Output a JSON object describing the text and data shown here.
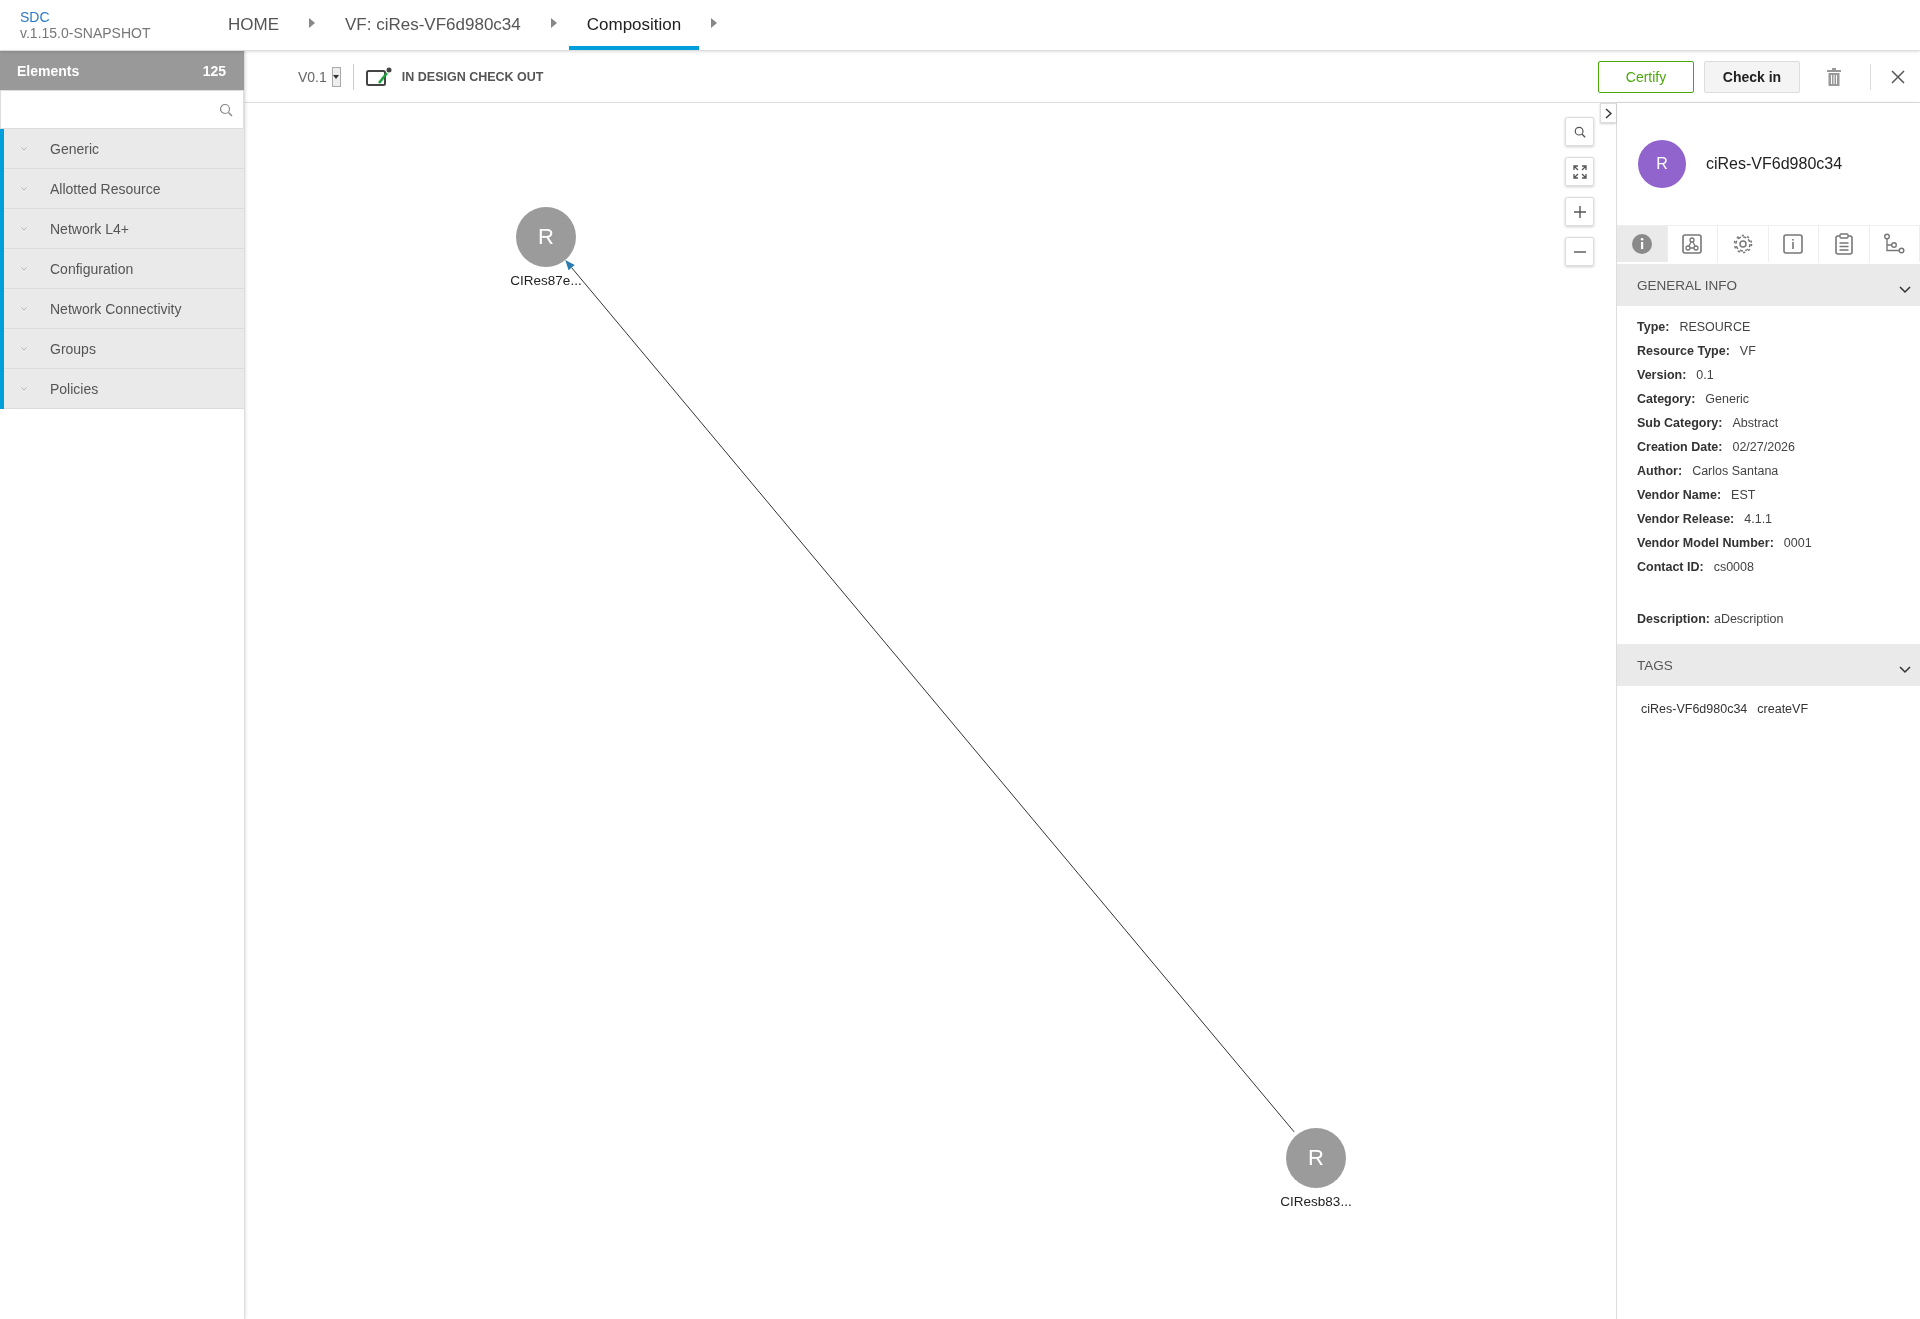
{
  "app": {
    "name": "SDC",
    "version": "v.1.15.0-SNAPSHOT"
  },
  "breadcrumbs": [
    {
      "label": "HOME",
      "selected": false
    },
    {
      "label": "VF: ciRes-VF6d980c34",
      "selected": false
    },
    {
      "label": "Composition",
      "selected": true
    }
  ],
  "elements_panel": {
    "title": "Elements",
    "count": "125",
    "categories": [
      {
        "label": "Generic",
        "expanded": false
      },
      {
        "label": "Allotted Resource",
        "expanded": false
      },
      {
        "label": "Network L4+",
        "expanded": false
      },
      {
        "label": "Configuration",
        "expanded": false
      },
      {
        "label": "Network Connectivity",
        "expanded": false
      },
      {
        "label": "Groups",
        "expanded": false
      },
      {
        "label": "Policies",
        "expanded": false
      }
    ]
  },
  "toolbar": {
    "version": "V0.1",
    "status": "IN DESIGN CHECK OUT",
    "buttons": [
      {
        "label": "Certify",
        "kind": "primary"
      },
      {
        "label": "Check in",
        "kind": "secondary"
      }
    ]
  },
  "canvas": {
    "nodes": [
      {
        "letter": "R",
        "label": "CIRes87e..."
      },
      {
        "letter": "R",
        "label": "CIResb83..."
      }
    ]
  },
  "details": {
    "avatar": "R",
    "title": "ciRes-VF6d980c34",
    "tabs": [
      {
        "selected": true
      },
      {
        "selected": false
      },
      {
        "selected": false
      },
      {
        "selected": false
      },
      {
        "selected": false
      },
      {
        "selected": false
      }
    ],
    "general": {
      "title": "GENERAL INFO",
      "expanded": true,
      "fields": [
        {
          "label": "Type:",
          "value": "RESOURCE"
        },
        {
          "label": "Resource Type:",
          "value": "VF"
        },
        {
          "label": "Version:",
          "value": "0.1"
        },
        {
          "label": "Category:",
          "value": "Generic"
        },
        {
          "label": "Sub Category:",
          "value": "Abstract"
        },
        {
          "label": "Creation Date:",
          "value": "02/27/2026"
        },
        {
          "label": "Author:",
          "value": "Carlos Santana"
        },
        {
          "label": "Vendor Name:",
          "value": "EST"
        },
        {
          "label": "Vendor Release:",
          "value": "4.1.1"
        },
        {
          "label": "Vendor Model Number:",
          "value": "0001"
        },
        {
          "label": "Contact ID:",
          "value": "cs0008"
        }
      ],
      "description": {
        "label": "Description:",
        "value": "aDescription"
      }
    },
    "tags": {
      "title": "TAGS",
      "expanded": true,
      "items": [
        "ciRes-VF6d980c34",
        "createVF"
      ]
    }
  }
}
